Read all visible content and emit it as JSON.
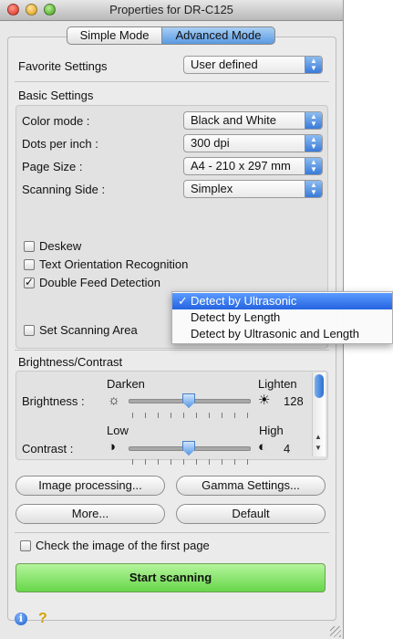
{
  "window": {
    "title": "Properties for DR-C125"
  },
  "modes": {
    "simple": "Simple Mode",
    "advanced": "Advanced Mode"
  },
  "favorite": {
    "label": "Favorite Settings",
    "value": "User defined"
  },
  "basic": {
    "heading": "Basic Settings",
    "color_mode": {
      "label": "Color mode :",
      "value": "Black and White"
    },
    "dpi": {
      "label": "Dots per inch :",
      "value": "300 dpi"
    },
    "page_size": {
      "label": "Page Size :",
      "value": "A4 - 210 x 297 mm"
    },
    "side": {
      "label": "Scanning Side :",
      "value": "Simplex"
    }
  },
  "options": {
    "deskew": {
      "label": "Deskew",
      "checked": false
    },
    "text_orientation": {
      "label": "Text Orientation Recognition",
      "checked": false
    },
    "double_feed": {
      "label": "Double Feed Detection",
      "checked": true
    },
    "set_area": {
      "label": "Set Scanning Area",
      "checked": false
    }
  },
  "double_feed_menu": {
    "checkmark": "✓",
    "items": [
      "Detect by Ultrasonic",
      "Detect by Length",
      "Detect by Ultrasonic and Length"
    ],
    "selected": 0
  },
  "brightness_contrast": {
    "heading": "Brightness/Contrast",
    "brightness": {
      "label": "Brightness :",
      "left": "Darken",
      "right": "Lighten",
      "value": "128",
      "level": 0.5
    },
    "contrast": {
      "label": "Contrast :",
      "left": "Low",
      "right": "High",
      "value": "4",
      "level": 0.5
    }
  },
  "buttons": {
    "image_processing": "Image processing...",
    "gamma": "Gamma Settings...",
    "more": "More...",
    "default": "Default",
    "start": "Start scanning"
  },
  "check_first_page": {
    "label": "Check the image of the first page",
    "checked": false
  },
  "footer": {
    "info_icon": "i",
    "help_icon": "?"
  },
  "colors": {
    "accent": "#3a7ad9",
    "start_button": "#67d64a"
  }
}
